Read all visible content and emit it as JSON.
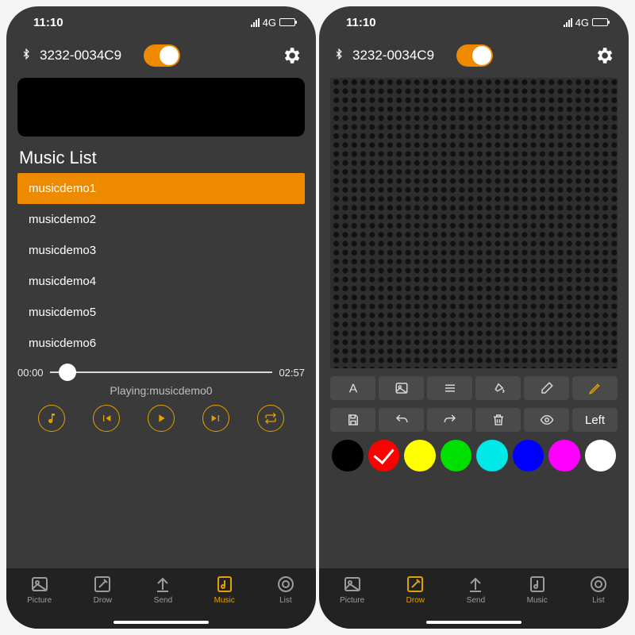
{
  "status": {
    "time": "11:10",
    "net": "4G"
  },
  "header": {
    "bt_glyph": "✢",
    "device": "3232-0034C9"
  },
  "left": {
    "section_title": "Music List",
    "items": [
      "musicdemo1",
      "musicdemo2",
      "musicdemo3",
      "musicdemo4",
      "musicdemo5",
      "musicdemo6"
    ],
    "selected_index": 0,
    "time_cur": "00:00",
    "time_total": "02:57",
    "progress_pct": 8,
    "nowplaying": "Playing:musicdemo0",
    "tabs": [
      "Picture",
      "Drow",
      "Send",
      "Music",
      "List"
    ],
    "active_tab": 3
  },
  "right": {
    "tool_left_label": "Left",
    "toolrow1": [
      "text-icon",
      "image-icon",
      "lines-icon",
      "bucket-icon",
      "eraser-icon",
      "pencil-icon"
    ],
    "toolrow2": [
      "save-icon",
      "undo-icon",
      "redo-icon",
      "trash-icon",
      "eye-icon",
      "left-label"
    ],
    "toolrow1_active": 5,
    "swatches": [
      "#000000",
      "#ff0000",
      "#ffff00",
      "#00e000",
      "#00e8e8",
      "#0000ff",
      "#ff00ff",
      "#ffffff"
    ],
    "swatch_sel": 1,
    "tabs": [
      "Picture",
      "Drow",
      "Send",
      "Music",
      "List"
    ],
    "active_tab": 1
  },
  "colors": {
    "accent": "#ee8a00",
    "accent2": "#e2a100"
  }
}
